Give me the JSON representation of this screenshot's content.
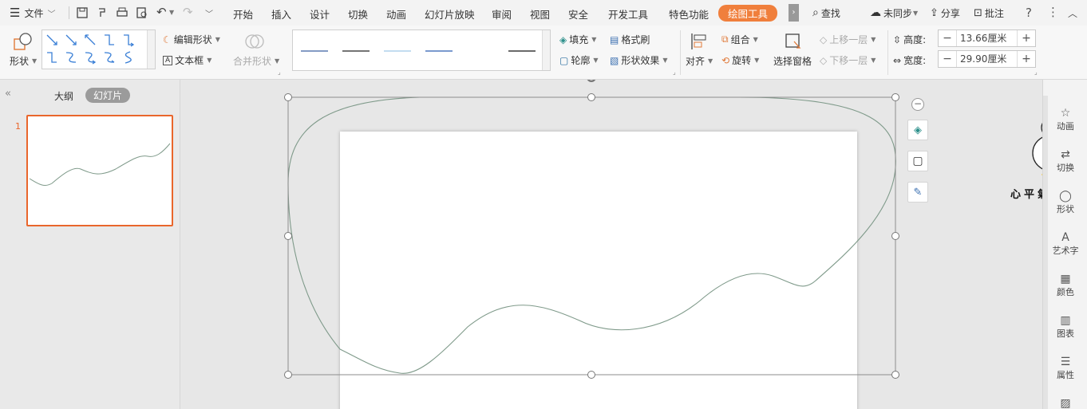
{
  "menubar": {
    "file_label": "文件",
    "tabs": [
      "开始",
      "插入",
      "设计",
      "切换",
      "动画",
      "幻灯片放映",
      "审阅",
      "视图",
      "安全",
      "开发工具",
      "特色功能",
      "绘图工具"
    ],
    "active_tab": "绘图工具",
    "search_label": "查找",
    "sync_label": "未同步",
    "share_label": "分享",
    "comment_label": "批注",
    "help_icon": "?"
  },
  "ribbon": {
    "shape_label": "形状",
    "edit_shape_label": "编辑形状",
    "textbox_label": "文本框",
    "merge_shape_label": "合并形状",
    "fill_label": "填充",
    "format_painter_label": "格式刷",
    "outline_label": "轮廓",
    "shape_effect_label": "形状效果",
    "align_label": "对齐",
    "group_label": "组合",
    "rotate_label": "旋转",
    "selection_pane_label": "选择窗格",
    "bring_forward_label": "上移一层",
    "send_backward_label": "下移一层",
    "height_label": "高度:",
    "height_value": "13.66厘米",
    "width_label": "宽度:",
    "width_value": "29.90厘米"
  },
  "left_pane": {
    "outline_tab": "大纲",
    "slides_tab": "幻灯片",
    "slide_number": "1"
  },
  "right_pane": {
    "items": [
      "动画",
      "切换",
      "形状",
      "艺术字",
      "颜色",
      "图表",
      "属性"
    ]
  },
  "sticker": {
    "text": "心平氣和鸭"
  },
  "colors": {
    "accent": "#f07f3c",
    "curve": "#7f9a8a",
    "slide_border_selected": "#e9662c"
  }
}
